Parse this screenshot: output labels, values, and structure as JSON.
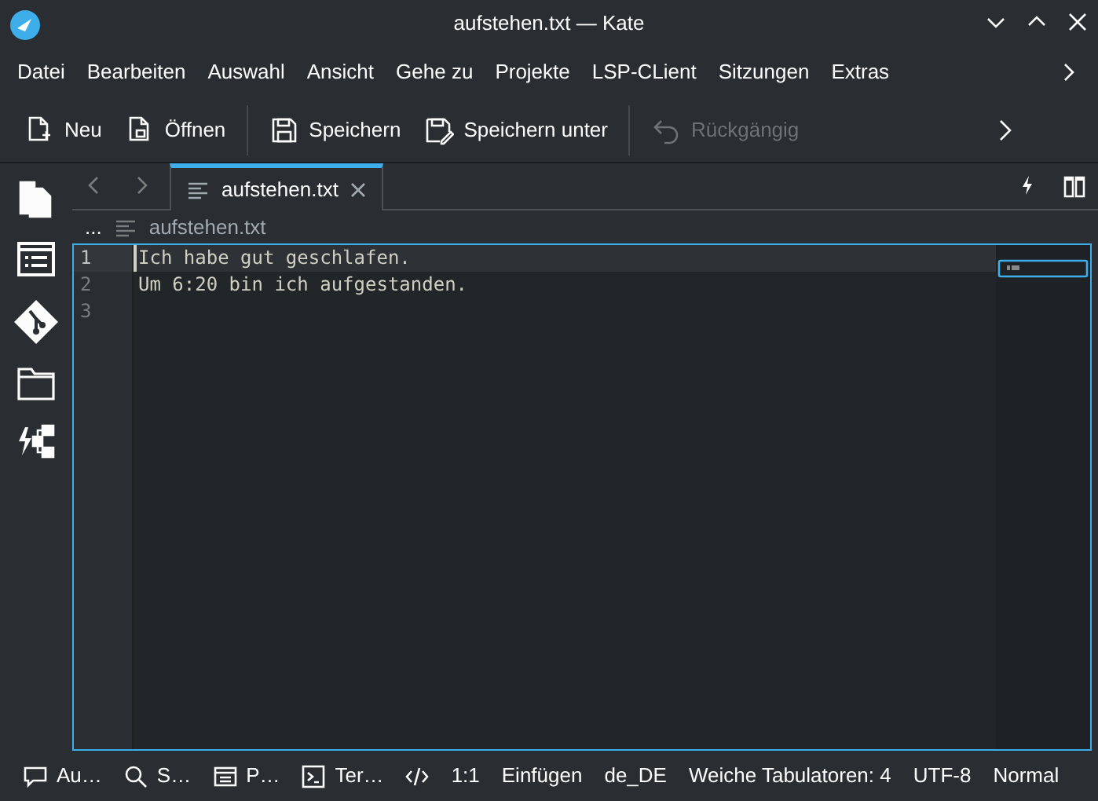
{
  "window": {
    "title": "aufstehen.txt — Kate"
  },
  "menu": [
    "Datei",
    "Bearbeiten",
    "Auswahl",
    "Ansicht",
    "Gehe zu",
    "Projekte",
    "LSP-CLient",
    "Sitzungen",
    "Extras"
  ],
  "toolbar": [
    {
      "label": "Neu",
      "kind": "new",
      "disabled": false
    },
    {
      "label": "Öffnen",
      "kind": "open",
      "disabled": false
    },
    {
      "label": "Speichern",
      "kind": "save",
      "disabled": false
    },
    {
      "label": "Speichern unter",
      "kind": "saveas",
      "disabled": false
    },
    {
      "label": "Rückgängig",
      "kind": "undo",
      "disabled": true
    }
  ],
  "tabs": [
    {
      "label": "aufstehen.txt",
      "selected": true
    }
  ],
  "breadcrumb": [
    "...",
    "aufstehen.txt"
  ],
  "editor": {
    "lines": [
      {
        "number": "1",
        "text": "Ich habe gut geschlafen.",
        "current": true
      },
      {
        "number": "2",
        "text": "Um 6:20 bin ich aufgestanden.",
        "current": false
      },
      {
        "number": "3",
        "current": false
      }
    ]
  },
  "status_bar": [
    {
      "label": "Au…",
      "kind": "comment"
    },
    {
      "label": "S…",
      "kind": "search"
    },
    {
      "label": "P…",
      "kind": "panel"
    },
    {
      "label": "Ter…",
      "kind": "terminal"
    },
    {
      "kind": "code"
    },
    {
      "label": "1:1",
      "kind": "text"
    },
    {
      "label": "Einfügen",
      "kind": "text"
    },
    {
      "label": "de_DE",
      "kind": "text"
    },
    {
      "label": "Weiche Tabulatoren: 4",
      "kind": "text"
    },
    {
      "label": "UTF-8",
      "kind": "text"
    },
    {
      "label": "Normal",
      "kind": "text"
    }
  ]
}
